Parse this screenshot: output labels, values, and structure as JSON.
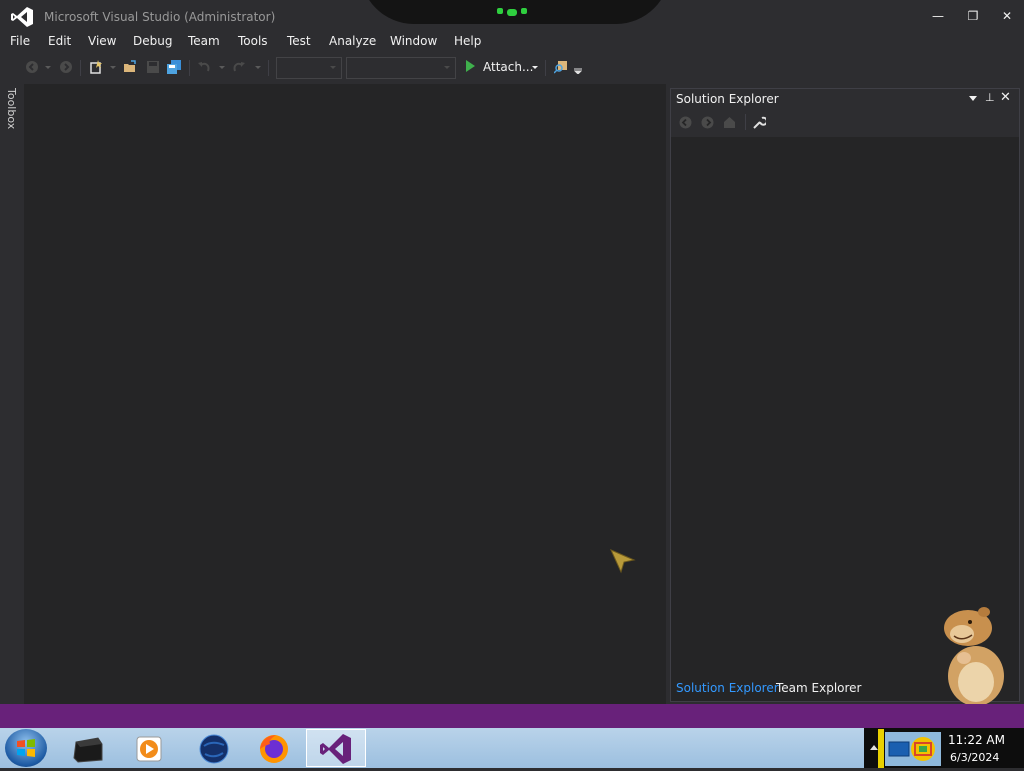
{
  "window": {
    "title": "Microsoft Visual Studio (Administrator)",
    "minimize_glyph": "—",
    "restore_glyph": "❐",
    "close_glyph": "✕"
  },
  "menu": [
    "File",
    "Edit",
    "View",
    "Debug",
    "Team",
    "Tools",
    "Test",
    "Analyze",
    "Window",
    "Help"
  ],
  "toolbar": {
    "attach_label": "Attach...",
    "icons": [
      "back-icon",
      "forward-icon",
      "new-project-icon",
      "open-file-icon",
      "save-icon",
      "save-all-icon",
      "undo-icon",
      "redo-icon",
      "find-icon"
    ]
  },
  "toolbox": {
    "label": "Toolbox"
  },
  "solution_explorer": {
    "title": "Solution Explorer",
    "pin_glyph": "⊥",
    "close_glyph": "✕",
    "toolbar_icons": [
      "back-icon",
      "forward-icon",
      "home-icon",
      "properties-wrench-icon"
    ],
    "tabs": [
      "Solution Explorer",
      "Team Explorer"
    ],
    "active_tab": "Solution Explorer"
  },
  "taskbar": {
    "apps": [
      "terminal-icon",
      "media-player-icon",
      "globe-icon",
      "firefox-icon",
      "visual-studio-icon"
    ],
    "active_app": "visual-studio-icon"
  },
  "clock": {
    "time": "11:22 AM",
    "date": "6/3/2024"
  },
  "colors": {
    "accent_purple": "#68217a",
    "active_tab_blue": "#3399ff",
    "background": "#2d2d30",
    "play_green": "#3fb04c"
  }
}
